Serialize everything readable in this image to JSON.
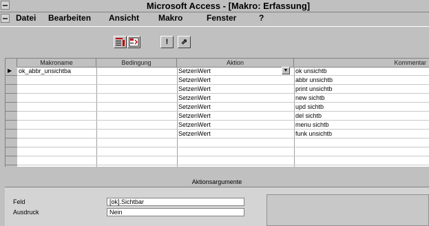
{
  "window": {
    "title": "Microsoft Access - [Makro: Erfassung]"
  },
  "menu": [
    {
      "label": "Datei"
    },
    {
      "label": "Bearbeiten"
    },
    {
      "label": "Ansicht"
    },
    {
      "label": "Makro"
    },
    {
      "label": "Fenster"
    },
    {
      "label": "?"
    }
  ],
  "toolbar": {
    "buttons": [
      "macro-names-icon",
      "conditions-icon",
      "run-icon",
      "single-step-icon"
    ],
    "run_glyph": "!",
    "step_glyph": "⇗"
  },
  "grid": {
    "columns": [
      "Makroname",
      "Bedingung",
      "Aktion",
      "Kommentar"
    ],
    "current_row_marker": "▶",
    "rows": [
      {
        "makroname": "ok_abbr_unsichtba",
        "bedingung": "",
        "aktion": "SetzenWert",
        "kommentar": "ok unsichtb"
      },
      {
        "makroname": "",
        "bedingung": "",
        "aktion": "SetzenWert",
        "kommentar": "abbr unsichtb"
      },
      {
        "makroname": "",
        "bedingung": "",
        "aktion": "SetzenWert",
        "kommentar": "print unsichtb"
      },
      {
        "makroname": "",
        "bedingung": "",
        "aktion": "SetzenWert",
        "kommentar": "new sichtb"
      },
      {
        "makroname": "",
        "bedingung": "",
        "aktion": "SetzenWert",
        "kommentar": "upd sichtb"
      },
      {
        "makroname": "",
        "bedingung": "",
        "aktion": "SetzenWert",
        "kommentar": "del sichtb"
      },
      {
        "makroname": "",
        "bedingung": "",
        "aktion": "SetzenWert",
        "kommentar": "menu sichtb"
      },
      {
        "makroname": "",
        "bedingung": "",
        "aktion": "SetzenWert",
        "kommentar": "funk unsichtb"
      }
    ]
  },
  "arguments": {
    "title": "Aktionsargumente",
    "feld_label": "Feld",
    "feld_value": "[ok].Sichtbar",
    "ausdruck_label": "Ausdruck",
    "ausdruck_value": "Nein"
  }
}
